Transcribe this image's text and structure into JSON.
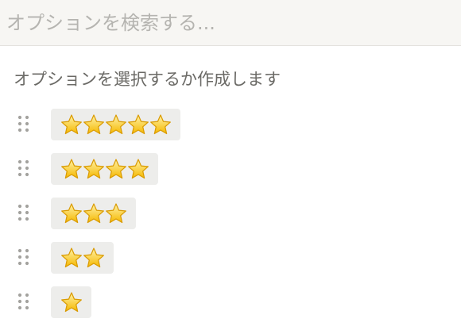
{
  "search": {
    "value": "",
    "placeholder": "オプションを検索する..."
  },
  "hint": {
    "text": "オプションを選択するか作成します"
  },
  "options": [
    {
      "value": "⭐⭐⭐⭐⭐",
      "stars": 5
    },
    {
      "value": "⭐⭐⭐⭐",
      "stars": 4
    },
    {
      "value": "⭐⭐⭐",
      "stars": 3
    },
    {
      "value": "⭐⭐",
      "stars": 2
    },
    {
      "value": "⭐",
      "stars": 1
    }
  ],
  "icons": {
    "drag_handle": "drag-handle-icon",
    "star": "star-icon"
  },
  "colors": {
    "search_background": "#f7f6f3",
    "chip_background": "#ededeb",
    "hint_text": "#6b6a66",
    "placeholder_text": "#b5b4b0",
    "handle_dots": "#a3a29e",
    "star_fill_top": "#fff2a8",
    "star_fill_bottom": "#f5b800",
    "star_outline": "#d99a00"
  }
}
